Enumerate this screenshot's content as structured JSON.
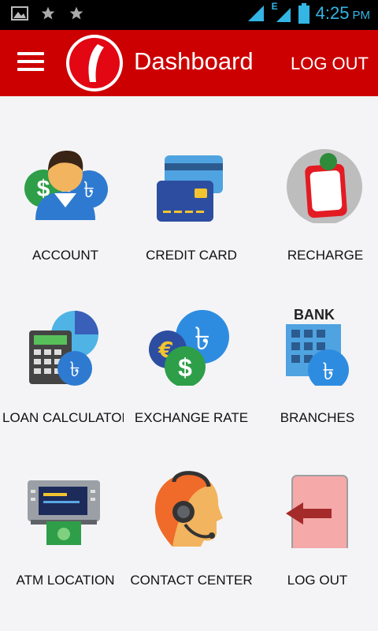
{
  "status_bar": {
    "time": "4:25",
    "ampm": "PM",
    "network": "E"
  },
  "app_bar": {
    "title": "Dashboard",
    "logout_label": "LOG OUT"
  },
  "colors": {
    "brand": "#cc0000",
    "status_time": "#33b5e5"
  },
  "tiles": [
    {
      "label": "ACCOUNT",
      "icon": "account-icon"
    },
    {
      "label": "CREDIT CARD",
      "icon": "credit-card-icon"
    },
    {
      "label": "RECHARGE",
      "icon": "recharge-icon"
    },
    {
      "label": "LOAN CALCULATOR",
      "icon": "loan-calculator-icon"
    },
    {
      "label": "EXCHANGE RATE",
      "icon": "exchange-rate-icon"
    },
    {
      "label": "BRANCHES",
      "icon": "branches-icon"
    },
    {
      "label": "ATM LOCATION",
      "icon": "atm-location-icon"
    },
    {
      "label": "CONTACT CENTER",
      "icon": "contact-center-icon"
    },
    {
      "label": "LOG OUT",
      "icon": "log-out-icon"
    }
  ],
  "icon_text": {
    "bank": "BANK",
    "taka": "৳",
    "dollar": "$",
    "euro": "€"
  }
}
